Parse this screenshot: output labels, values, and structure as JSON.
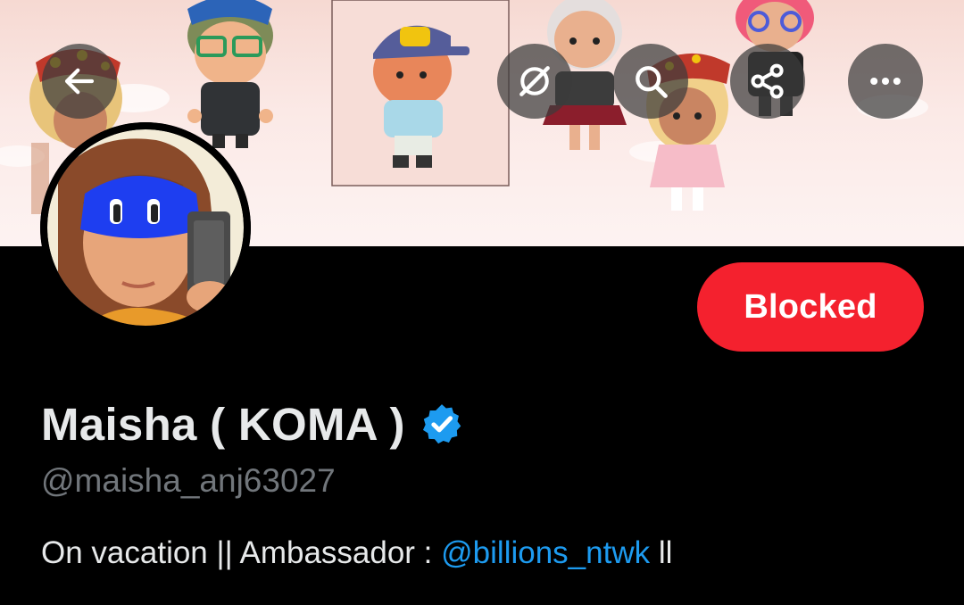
{
  "header": {
    "back_icon": "arrow-left-icon",
    "grok_icon": "grok-icon",
    "search_icon": "search-icon",
    "share_icon": "share-icon",
    "more_icon": "more-horizontal-icon"
  },
  "profile": {
    "display_name": "Maisha ( KOMA )",
    "verified": true,
    "handle": "@maisha_anj63027",
    "bio_prefix": "On vacation || Ambassador : ",
    "bio_mention": "@billions_ntwk",
    "bio_suffix": " ll"
  },
  "actions": {
    "blocked_label": "Blocked"
  },
  "colors": {
    "background": "#000000",
    "blocked_button": "#f4212e",
    "mention": "#1d9bf0",
    "verified": "#1d9bf0",
    "primary_text": "#e7e9ea",
    "secondary_text": "#71767b"
  }
}
